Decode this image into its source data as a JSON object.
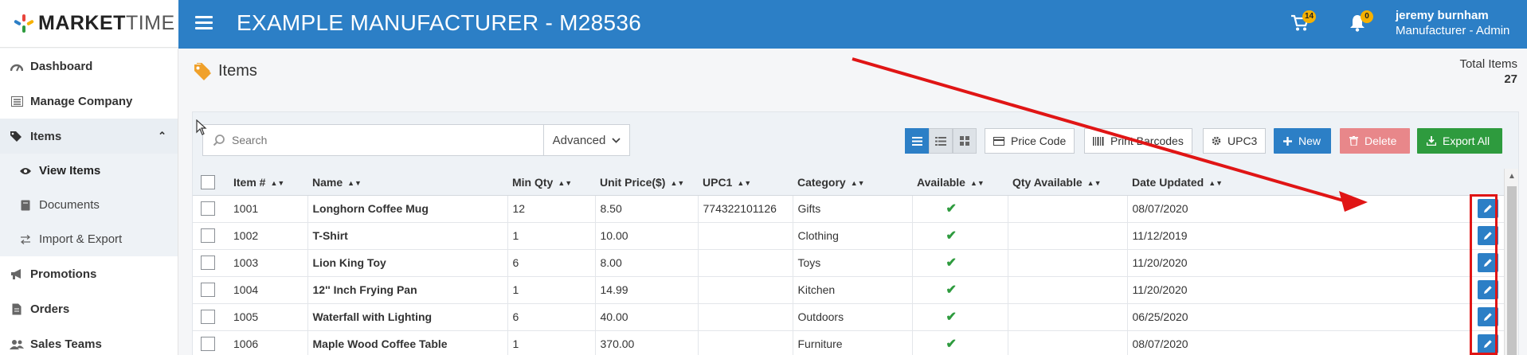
{
  "app": {
    "logo_bold": "MARKET",
    "logo_thin": "TIME",
    "company_title": "EXAMPLE MANUFACTURER - M28536"
  },
  "topbar": {
    "cart_count": "14",
    "notif_count": "0",
    "user_name": "jeremy burnham",
    "user_role": "Manufacturer - Admin"
  },
  "sidebar": {
    "items": [
      {
        "label": "Dashboard",
        "icon": "dashboard-icon"
      },
      {
        "label": "Manage Company",
        "icon": "list-icon"
      },
      {
        "label": "Items",
        "icon": "tags-icon"
      },
      {
        "label": "View Items",
        "icon": "eye-icon"
      },
      {
        "label": "Documents",
        "icon": "book-icon"
      },
      {
        "label": "Import & Export",
        "icon": "exchange-icon"
      },
      {
        "label": "Promotions",
        "icon": "bullhorn-icon"
      },
      {
        "label": "Orders",
        "icon": "file-icon"
      },
      {
        "label": "Sales Teams",
        "icon": "users-icon"
      }
    ]
  },
  "page": {
    "title": "Items",
    "total_label": "Total Items",
    "total_value": "27"
  },
  "toolbar": {
    "search_placeholder": "Search",
    "advanced_label": "Advanced",
    "price_code_label": "Price Code",
    "print_barcodes_label": "Print Barcodes",
    "upc_label": "UPC3",
    "new_label": "New",
    "delete_label": "Delete",
    "export_label": "Export All"
  },
  "table": {
    "headers": [
      "Item #",
      "Name",
      "Min Qty",
      "Unit Price($)",
      "UPC1",
      "Category",
      "Available",
      "Qty Available",
      "Date Updated"
    ],
    "rows": [
      {
        "item": "1001",
        "name": "Longhorn Coffee Mug",
        "min_qty": "12",
        "price": "8.50",
        "upc1": "774322101126",
        "category": "Gifts",
        "available": true,
        "qty": "",
        "date": "08/07/2020"
      },
      {
        "item": "1002",
        "name": "T-Shirt",
        "min_qty": "1",
        "price": "10.00",
        "upc1": "",
        "category": "Clothing",
        "available": true,
        "qty": "",
        "date": "11/12/2019"
      },
      {
        "item": "1003",
        "name": "Lion King Toy",
        "min_qty": "6",
        "price": "8.00",
        "upc1": "",
        "category": "Toys",
        "available": true,
        "qty": "",
        "date": "11/20/2020"
      },
      {
        "item": "1004",
        "name": "12'' Inch Frying Pan",
        "min_qty": "1",
        "price": "14.99",
        "upc1": "",
        "category": "Kitchen",
        "available": true,
        "qty": "",
        "date": "11/20/2020"
      },
      {
        "item": "1005",
        "name": "Waterfall with Lighting",
        "min_qty": "6",
        "price": "40.00",
        "upc1": "",
        "category": "Outdoors",
        "available": true,
        "qty": "",
        "date": "06/25/2020"
      },
      {
        "item": "1006",
        "name": "Maple Wood Coffee Table",
        "min_qty": "1",
        "price": "370.00",
        "upc1": "",
        "category": "Furniture",
        "available": true,
        "qty": "",
        "date": "08/07/2020"
      }
    ]
  },
  "colors": {
    "primary": "#2c7fc6",
    "success": "#2e9b3e",
    "danger": "#e8878a",
    "annotation": "#e01515",
    "badge": "#f6b100"
  }
}
